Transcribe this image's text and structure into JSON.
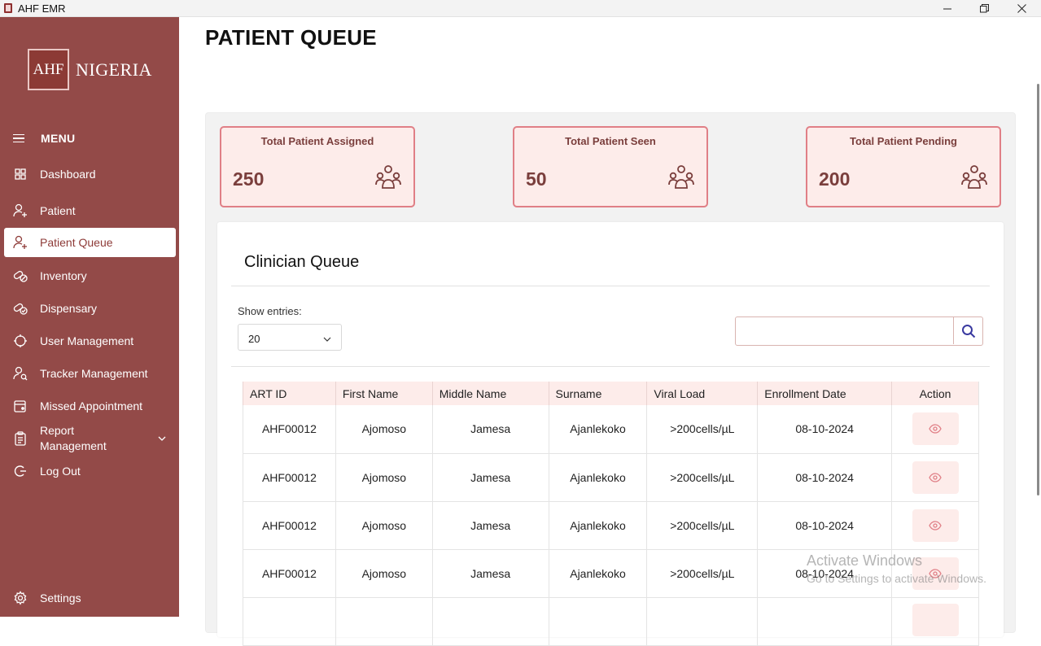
{
  "window": {
    "title": "AHF EMR",
    "min_glyph": "—",
    "max_glyph": "❐",
    "close_glyph": "✕"
  },
  "sidebar": {
    "logo": {
      "mark": "AHF",
      "text": "NIGERIA"
    },
    "menu_label": "MENU",
    "items": [
      {
        "label": "Dashboard",
        "icon": "grid-icon"
      },
      {
        "label": "Patient",
        "icon": "user-add-icon"
      },
      {
        "label": "Patient Queue",
        "icon": "user-add-icon",
        "active": true
      },
      {
        "label": "Inventory",
        "icon": "pills-icon"
      },
      {
        "label": "Dispensary",
        "icon": "medication-icon"
      },
      {
        "label": "User Management",
        "icon": "target-icon"
      },
      {
        "label": "Tracker Management",
        "icon": "user-search-icon"
      },
      {
        "label": "Missed Appointment",
        "icon": "calendar-icon"
      },
      {
        "label": "Report Management",
        "icon": "clipboard-icon",
        "expandable": true
      },
      {
        "label": "Log Out",
        "icon": "logout-icon"
      }
    ],
    "settings_label": "Settings"
  },
  "page": {
    "title": "PATIENT QUEUE"
  },
  "stats": [
    {
      "label": "Total Patient Assigned",
      "value": "250"
    },
    {
      "label": "Total Patient Seen",
      "value": "50"
    },
    {
      "label": "Total Patient Pending",
      "value": "200"
    }
  ],
  "queue": {
    "title": "Clinician Queue",
    "show_entries_label": "Show entries:",
    "entries_value": "20",
    "search_placeholder": "",
    "columns": [
      "ART ID",
      "First Name",
      "Middle Name",
      "Surname",
      "Viral Load",
      "Enrollment Date",
      "Action"
    ],
    "rows": [
      [
        "AHF00012",
        "Ajomoso",
        "Jamesa",
        "Ajanlekoko",
        ">200cells/µL",
        "08-10-2024"
      ],
      [
        "AHF00012",
        "Ajomoso",
        "Jamesa",
        "Ajanlekoko",
        ">200cells/µL",
        "08-10-2024"
      ],
      [
        "AHF00012",
        "Ajomoso",
        "Jamesa",
        "Ajanlekoko",
        ">200cells/µL",
        "08-10-2024"
      ],
      [
        "AHF00012",
        "Ajomoso",
        "Jamesa",
        "Ajanlekoko",
        ">200cells/µL",
        "08-10-2024"
      ],
      [
        "",
        "",
        "",
        "",
        "",
        ""
      ]
    ]
  },
  "watermark": {
    "line1": "Activate Windows",
    "line2": "Go to Settings to activate Windows."
  },
  "colors": {
    "sidebar": "#934a48",
    "accent": "#8e3b38",
    "card_fill": "#fdecea",
    "card_border": "#e07f86"
  }
}
